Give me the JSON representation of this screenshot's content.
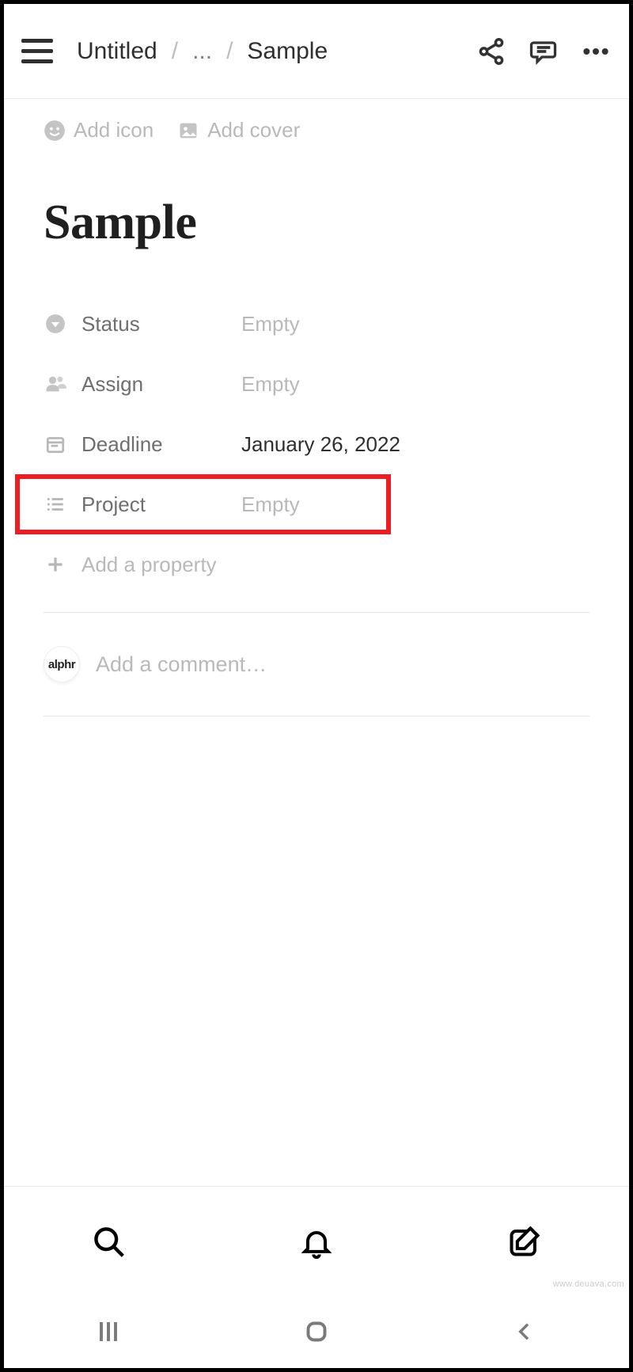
{
  "breadcrumbs": {
    "root": "Untitled",
    "ellipsis": "...",
    "current": "Sample"
  },
  "cover_actions": {
    "add_icon": "Add icon",
    "add_cover": "Add cover"
  },
  "page": {
    "title": "Sample"
  },
  "properties": [
    {
      "label": "Status",
      "value": "Empty",
      "empty": true,
      "icon": "dropdown"
    },
    {
      "label": "Assign",
      "value": "Empty",
      "empty": true,
      "icon": "people"
    },
    {
      "label": "Deadline",
      "value": "January 26, 2022",
      "empty": false,
      "icon": "calendar"
    },
    {
      "label": "Project",
      "value": "Empty",
      "empty": true,
      "icon": "list",
      "highlighted": true
    }
  ],
  "add_property": "Add a property",
  "comment": {
    "avatar_text": "alphr",
    "placeholder": "Add a comment…"
  },
  "watermark": "www.deuava.com"
}
